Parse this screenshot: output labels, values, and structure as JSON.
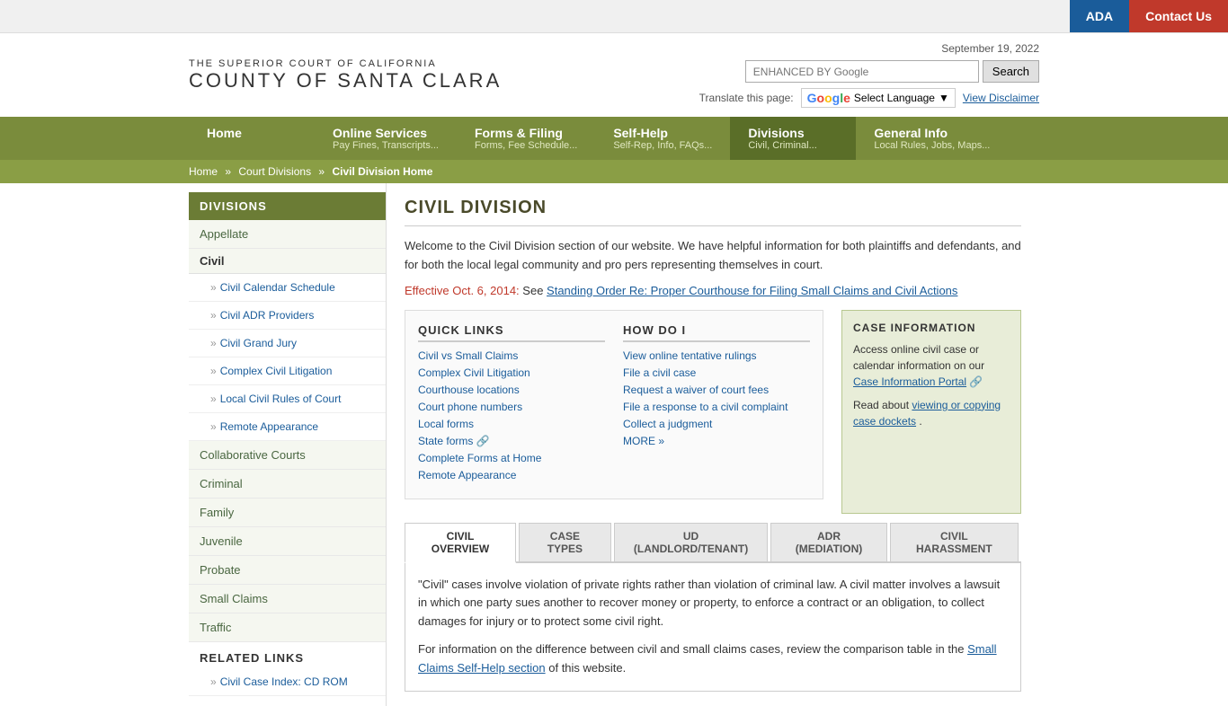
{
  "topbar": {
    "ada_label": "ADA",
    "contact_label": "Contact Us"
  },
  "header": {
    "logo_top": "The Superior Court of California",
    "logo_bottom": "County of Santa Clara",
    "date": "September 19, 2022",
    "search_placeholder": "ENHANCED BY Google",
    "search_btn": "Search",
    "translate_label": "Translate this page:",
    "lang_select": "Select Language",
    "view_disclaimer": "View Disclaimer"
  },
  "nav": {
    "items": [
      {
        "title": "Home",
        "sub": ""
      },
      {
        "title": "Online Services",
        "sub": "Pay Fines, Transcripts..."
      },
      {
        "title": "Forms & Filing",
        "sub": "Forms, Fee Schedule..."
      },
      {
        "title": "Self-Help",
        "sub": "Self-Rep, Info, FAQs..."
      },
      {
        "title": "Divisions",
        "sub": "Civil, Criminal...",
        "active": true
      },
      {
        "title": "General Info",
        "sub": "Local Rules, Jobs, Maps..."
      }
    ]
  },
  "breadcrumb": {
    "home": "Home",
    "divisions": "Court Divisions",
    "current": "Civil Division Home"
  },
  "sidebar": {
    "section_label": "DIVISIONS",
    "items": [
      {
        "label": "Appellate",
        "type": "top"
      },
      {
        "label": "Civil",
        "type": "group"
      },
      {
        "label": "Civil Calendar Schedule",
        "type": "sub"
      },
      {
        "label": "Civil ADR Providers",
        "type": "sub"
      },
      {
        "label": "Civil Grand Jury",
        "type": "sub"
      },
      {
        "label": "Complex Civil Litigation",
        "type": "sub"
      },
      {
        "label": "Local Civil Rules of Court",
        "type": "sub"
      },
      {
        "label": "Remote Appearance",
        "type": "sub"
      },
      {
        "label": "Collaborative Courts",
        "type": "top"
      },
      {
        "label": "Criminal",
        "type": "top"
      },
      {
        "label": "Family",
        "type": "top"
      },
      {
        "label": "Juvenile",
        "type": "top"
      },
      {
        "label": "Probate",
        "type": "top"
      },
      {
        "label": "Small Claims",
        "type": "top"
      },
      {
        "label": "Traffic",
        "type": "top"
      }
    ],
    "related_label": "RELATED LINKS",
    "related_items": [
      "Civil Case Index: CD ROM"
    ]
  },
  "main": {
    "page_title": "CIVIL DIVISION",
    "intro_p1": "Welcome to the Civil Division section of our website. We have helpful information for both plaintiffs and defendants, and for both the local legal community and pro pers representing themselves in court.",
    "effective_prefix": "Effective Oct. 6, 2014:",
    "effective_see": " See ",
    "effective_link": "Standing Order Re: Proper Courthouse for Filing Small Claims and Civil Actions",
    "quick_links_title": "QUICK LINKS",
    "quick_links": [
      {
        "label": "Civil vs Small Claims",
        "ext": false
      },
      {
        "label": "Complex Civil Litigation",
        "ext": false
      },
      {
        "label": "Courthouse locations",
        "ext": false
      },
      {
        "label": "Court phone numbers",
        "ext": false
      },
      {
        "label": "Local forms",
        "ext": false
      },
      {
        "label": "State forms",
        "ext": true
      },
      {
        "label": "Complete Forms at Home",
        "ext": false
      },
      {
        "label": "Remote Appearance",
        "ext": false
      }
    ],
    "how_do_i_title": "HOW DO I",
    "how_do_i_links": [
      "View online tentative rulings",
      "File a civil case",
      "Request a waiver of court fees",
      "File a response to a civil complaint",
      "Collect a judgment",
      "MORE »"
    ],
    "case_info_title": "CASE INFORMATION",
    "case_info_text1": "Access online civil case or calendar information on our ",
    "case_info_link1": "Case Information Portal",
    "case_info_text2": "Read about ",
    "case_info_link2": "viewing or copying case dockets",
    "case_info_text2b": ".",
    "tabs": [
      {
        "label": "CIVIL OVERVIEW",
        "active": true
      },
      {
        "label": "CASE TYPES"
      },
      {
        "label": "UD (LANDLORD/TENANT)"
      },
      {
        "label": "ADR (MEDIATION)"
      },
      {
        "label": "CIVIL HARASSMENT"
      }
    ],
    "tab_content_p1": "\"Civil\" cases involve violation of private rights rather than violation of criminal law. A civil matter involves a lawsuit in which one party sues another to recover money or property, to enforce a contract or an obligation, to collect damages for injury or to protect some civil right.",
    "tab_content_p2": "For information on the difference between civil and small claims cases, review the comparison table in the ",
    "tab_content_link": "Small Claims Self-Help section",
    "tab_content_p2b": " of this website."
  }
}
